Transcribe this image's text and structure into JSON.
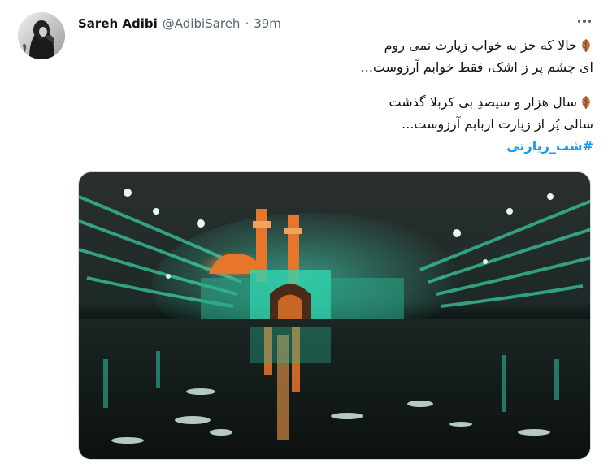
{
  "tweet": {
    "author": {
      "display_name": "Sareh Adibi",
      "handle": "@AdibiSareh",
      "separator": "·",
      "time": "39m"
    },
    "lines": [
      "حالا که جز به خواب زیارت نمی روم",
      "ای چشم پر ز اشک، فقط خوابم آرزوست...",
      "سال هزار و سیصدِ بی کربلا گذشت",
      "سالی پُر از زیارت اربابم آرزوست..."
    ],
    "hashtag": "#شب_زیارتی",
    "leaf_emoji": "leaf-icon",
    "media": {
      "kind": "photo",
      "subject": "shrine-at-night-reflected-in-water"
    }
  },
  "colors": {
    "text": "#0f1419",
    "secondary": "#536471",
    "accent": "#1d9bf0",
    "shrine_teal": "#2fd6b0",
    "dome_orange": "#e8762a"
  }
}
